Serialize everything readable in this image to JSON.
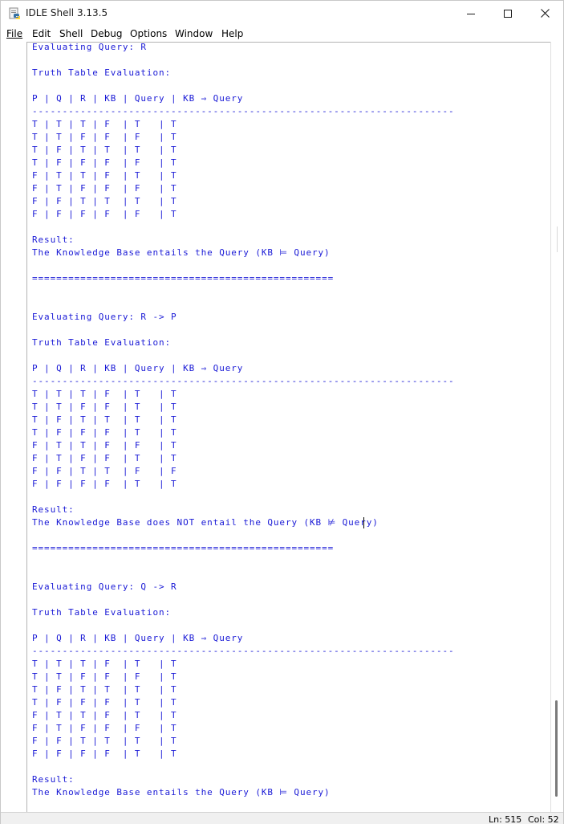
{
  "window": {
    "title": "IDLE Shell 3.13.5"
  },
  "menu": [
    "File",
    "Edit",
    "Shell",
    "Debug",
    "Options",
    "Window",
    "Help"
  ],
  "shell": {
    "lines": [
      "Evaluating Query: R",
      "",
      "Truth Table Evaluation:",
      "",
      "P | Q | R | KB | Query | KB ⇒ Query",
      "----------------------------------------------------------------------",
      "T | T | T | F  | T   | T",
      "T | T | F | F  | F   | T",
      "T | F | T | T  | T   | T",
      "T | F | F | F  | F   | T",
      "F | T | T | F  | T   | T",
      "F | T | F | F  | F   | T",
      "F | F | T | T  | T   | T",
      "F | F | F | F  | F   | T",
      "",
      "Result:",
      "The Knowledge Base entails the Query (KB ⊨ Query)",
      "",
      "==================================================",
      "",
      "",
      "Evaluating Query: R -> P",
      "",
      "Truth Table Evaluation:",
      "",
      "P | Q | R | KB | Query | KB ⇒ Query",
      "----------------------------------------------------------------------",
      "T | T | T | F  | T   | T",
      "T | T | F | F  | T   | T",
      "T | F | T | T  | T   | T",
      "T | F | F | F  | T   | T",
      "F | T | T | F  | F   | T",
      "F | T | F | F  | T   | T",
      "F | F | T | T  | F   | F",
      "F | F | F | F  | T   | T",
      "",
      "Result:",
      "The Knowledge Base does NOT entail the Query (KB ⊭ Query)",
      "",
      "==================================================",
      "",
      "",
      "Evaluating Query: Q -> R",
      "",
      "Truth Table Evaluation:",
      "",
      "P | Q | R | KB | Query | KB ⇒ Query",
      "----------------------------------------------------------------------",
      "T | T | T | F  | T   | T",
      "T | T | F | F  | F   | T",
      "T | F | T | T  | T   | T",
      "T | F | F | F  | T   | T",
      "F | T | T | F  | T   | T",
      "F | T | F | F  | F   | T",
      "F | F | T | T  | T   | T",
      "F | F | F | F  | T   | T",
      "",
      "Result:",
      "The Knowledge Base entails the Query (KB ⊨ Query)"
    ]
  },
  "status": {
    "line": "Ln: 515",
    "col": "Col: 52"
  },
  "colors": {
    "output_text": "#1a1ad6"
  },
  "icons": {
    "app": "idle-python-icon",
    "minimize": "minimize-icon",
    "maximize": "maximize-icon",
    "close": "close-icon"
  }
}
